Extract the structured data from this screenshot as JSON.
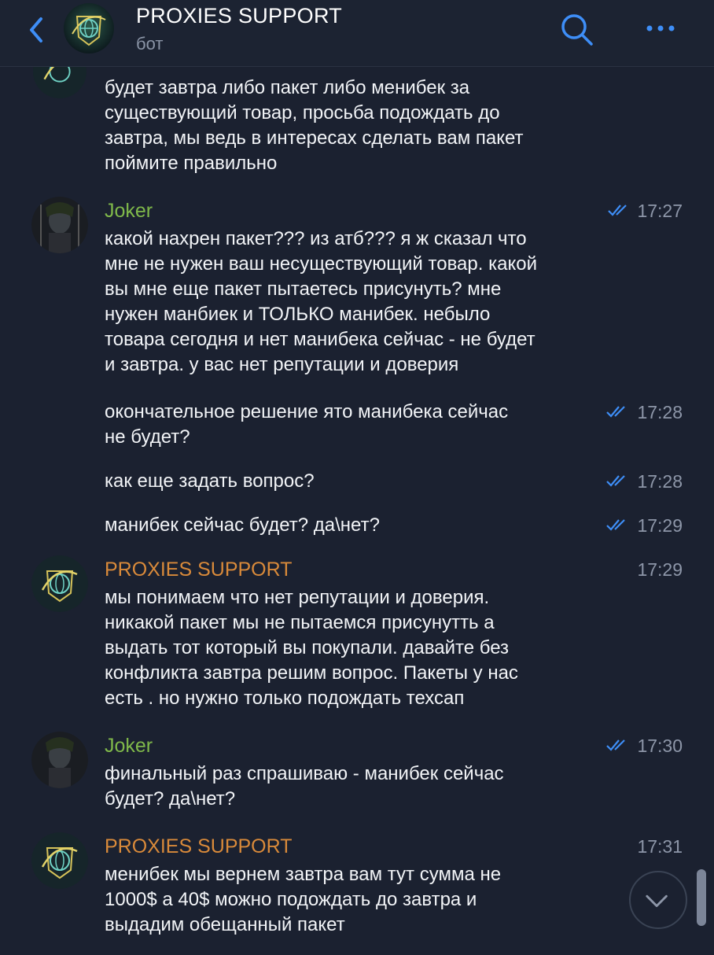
{
  "header": {
    "title": "PROXIES SUPPORT",
    "subtitle": "бот"
  },
  "messages": [
    {
      "lines": "будет завтра либо пакет либо менибек за\nсуществующий товар, просьба подождать до\nзавтра, мы ведь в интересах сделать вам пакет\nпоймите правильно"
    },
    {
      "sender": "Joker",
      "time": "17:27",
      "lines": "какой нахрен пакет??? из атб??? я ж сказал что\nмне не нужен ваш несуществующий товар. какой\nвы мне еще пакет пытаетесь присунуть? мне\nнужен манбиек и ТОЛЬКО манибек. небыло\nтовара сегодня и нет манибека сейчас - не будет\nи завтра. у вас нет репутации и доверия"
    },
    {
      "time": "17:28",
      "lines": "окончательное решение ято манибека сейчас\nне будет?"
    },
    {
      "time": "17:28",
      "lines": "как еще задать вопрос?"
    },
    {
      "time": "17:29",
      "lines": "манибек сейчас будет? да\\нет?"
    },
    {
      "sender": "PROXIES SUPPORT",
      "time": "17:29",
      "lines": "мы понимаем что нет репутации и доверия.\nникакой пакет мы не пытаемся присунутть а\nвыдать тот который вы покупали. давайте без\nконфликта завтра решим вопрос. Пакеты у нас\nесть . но нужно только подождать техсап"
    },
    {
      "sender": "Joker",
      "time": "17:30",
      "lines": "финальный раз спрашиваю - манибек сейчас\nбудет? да\\нет?"
    },
    {
      "sender": "PROXIES SUPPORT",
      "time": "17:31",
      "lines": "менибек мы вернем завтра вам тут сумма не\n1000$ а 40$ можно подождать до завтра и\nвыдадим обещанный пакет"
    }
  ],
  "colors": {
    "background": "#1b2130",
    "accent": "#3e8ef7",
    "joker_name": "#7fb84a",
    "proxies_name": "#d98a3a",
    "read_ticks": "#3e8ef7"
  },
  "icons": [
    "back-chevron-icon",
    "search-icon",
    "more-icon",
    "double-check-icon",
    "scroll-down-icon"
  ]
}
